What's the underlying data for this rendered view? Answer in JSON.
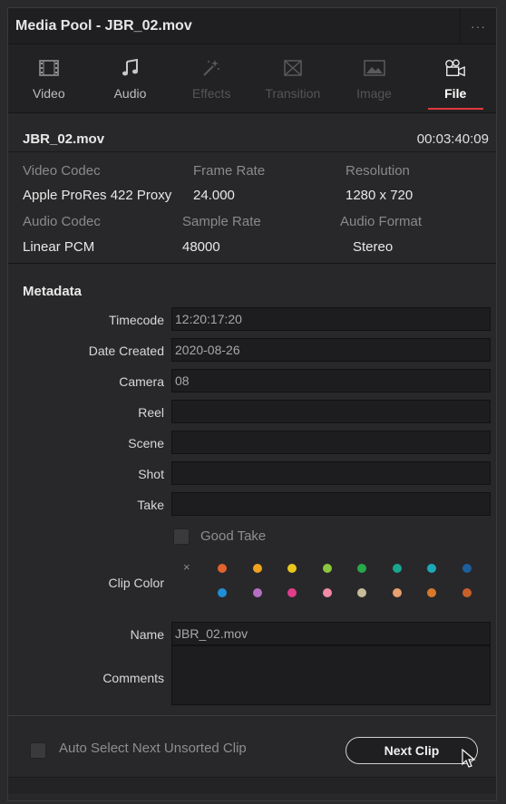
{
  "window": {
    "title": "Media Pool - JBR_02.mov",
    "more": "···"
  },
  "tabs": [
    {
      "label": "Video",
      "icon": "film-icon",
      "state": "enabled"
    },
    {
      "label": "Audio",
      "icon": "music-note-icon",
      "state": "enabled"
    },
    {
      "label": "Effects",
      "icon": "magic-wand-icon",
      "state": "disabled"
    },
    {
      "label": "Transition",
      "icon": "transition-icon",
      "state": "disabled"
    },
    {
      "label": "Image",
      "icon": "image-icon",
      "state": "disabled"
    },
    {
      "label": "File",
      "icon": "file-reel-icon",
      "state": "active"
    }
  ],
  "clip": {
    "name": "JBR_02.mov",
    "duration": "00:03:40:09",
    "video_codec_label": "Video Codec",
    "video_codec": "Apple ProRes 422 Proxy",
    "frame_rate_label": "Frame Rate",
    "frame_rate": "24.000",
    "resolution_label": "Resolution",
    "resolution": "1280 x 720",
    "audio_codec_label": "Audio Codec",
    "audio_codec": "Linear PCM",
    "sample_rate_label": "Sample Rate",
    "sample_rate": "48000",
    "audio_format_label": "Audio Format",
    "audio_format": "Stereo"
  },
  "metadata": {
    "heading": "Metadata",
    "timecode_label": "Timecode",
    "timecode": "12:20:17:20",
    "date_label": "Date Created",
    "date": "2020-08-26",
    "camera_label": "Camera",
    "camera": "08",
    "reel_label": "Reel",
    "reel": "",
    "scene_label": "Scene",
    "scene": "",
    "shot_label": "Shot",
    "shot": "",
    "take_label": "Take",
    "take": "",
    "good_take_label": "Good Take",
    "clip_color_label": "Clip Color",
    "clip_color_none": "×",
    "clip_colors_row1": [
      "#e0622c",
      "#f0a21f",
      "#e8c81c",
      "#8cc63f",
      "#27a84a",
      "#1aa58f",
      "#1ba9b8",
      "#1d5f9c"
    ],
    "clip_colors_row2": [
      "#1f8fd6",
      "#b46fc4",
      "#e03c8a",
      "#f28aa8",
      "#c8bb9a",
      "#e8a070",
      "#d9782b",
      "#c8602a"
    ],
    "name_label": "Name",
    "name": "JBR_02.mov",
    "comments_label": "Comments",
    "comments": ""
  },
  "bottom": {
    "auto_select_label": "Auto Select Next Unsorted Clip",
    "next_clip_label": "Next Clip"
  }
}
